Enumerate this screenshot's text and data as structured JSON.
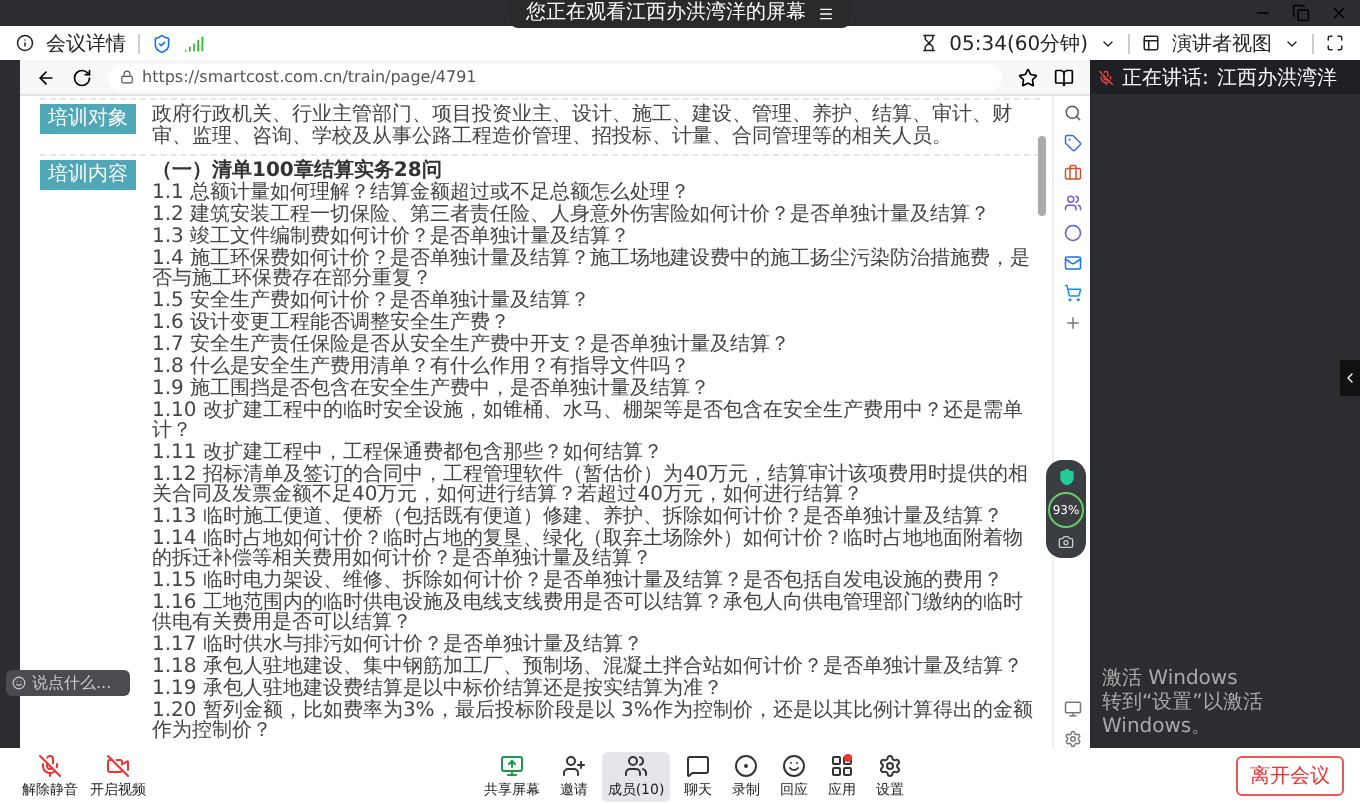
{
  "share_banner": {
    "text": "您正在观看江西办洪湾洋的屏幕"
  },
  "meeting_bar": {
    "details": "会议详情",
    "timer": "05:34(60分钟)",
    "view": "演讲者视图"
  },
  "browser": {
    "url": "https://smartcost.com.cn/train/page/4791"
  },
  "speaking": {
    "label": "正在讲话:",
    "name": "江西办洪湾洋"
  },
  "sections": [
    {
      "label": "培训对象",
      "paragraph": "政府行政机关、行业主管部门、项目投资业主、设计、施工、建设、管理、养护、结算、审计、财审、监理、咨询、学校及从事公路工程造价管理、招投标、计量、合同管理等的相关人员。"
    },
    {
      "label": "培训内容",
      "heading": "（一）清单100章结算实务28问",
      "items": [
        "1.1 总额计量如何理解？结算金额超过或不足总额怎么处理？",
        "1.2 建筑安装工程一切保险、第三者责任险、人身意外伤害险如何计价？是否单独计量及结算？",
        "1.3 竣工文件编制费如何计价？是否单独计量及结算？",
        "1.4 施工环保费如何计价？是否单独计量及结算？施工场地建设费中的施工扬尘污染防治措施费，是否与施工环保费存在部分重复？",
        "1.5 安全生产费如何计价？是否单独计量及结算？",
        "1.6 设计变更工程能否调整安全生产费？",
        "1.7 安全生产责任保险是否从安全生产费中开支？是否单独计量及结算？",
        "1.8 什么是安全生产费用清单？有什么作用？有指导文件吗？",
        "1.9 施工围挡是否包含在安全生产费中，是否单独计量及结算？",
        "1.10 改扩建工程中的临时安全设施，如锥桶、水马、棚架等是否包含在安全生产费用中？还是需单计？",
        "1.11 改扩建工程中，工程保通费都包含那些？如何结算？",
        "1.12 招标清单及签订的合同中，工程管理软件（暂估价）为40万元，结算审计该项费用时提供的相关合同及发票金额不足40万元，如何进行结算？若超过40万元，如何进行结算？",
        "1.13 临时施工便道、便桥（包括既有便道）修建、养护、拆除如何计价？是否单独计量及结算？",
        "1.14 临时占地如何计价？临时占地的复垦、绿化（取弃土场除外）如何计价？临时占地地面附着物的拆迁补偿等相关费用如何计价？是否单独计量及结算？",
        "1.15 临时电力架设、维修、拆除如何计价？是否单独计量及结算？是否包括自发电设施的费用？",
        "1.16 工地范围内的临时供电设施及电线支线费用是否可以结算？承包人向供电管理部门缴纳的临时供电有关费用是否可以结算？",
        "1.17 临时供水与排污如何计价？是否单独计量及结算？",
        "1.18 承包人驻地建设、集中钢筋加工厂、预制场、混凝土拌合站如何计价？是否单独计量及结算？",
        "1.19 承包人驻地建设费结算是以中标价结算还是按实结算为准？",
        "1.20 暂列金额，比如费率为3%，最后投标阶段是以 3%作为控制价，还是以其比例计算得出的金额作为控制价？"
      ]
    }
  ],
  "security_widget": {
    "score": "93",
    "unit": "%"
  },
  "chat_input": {
    "placeholder": "说点什么..."
  },
  "toolbar": {
    "left": [
      {
        "kind": "mic",
        "label": "解除静音",
        "off": true
      },
      {
        "kind": "video",
        "label": "开启视频",
        "off": true
      }
    ],
    "center": [
      {
        "kind": "share",
        "label": "共享屏幕",
        "selected": false,
        "dot": false
      },
      {
        "kind": "invite",
        "label": "邀请",
        "selected": false,
        "dot": false
      },
      {
        "kind": "members",
        "label": "成员(10)",
        "selected": true,
        "dot": false
      },
      {
        "kind": "chat",
        "label": "聊天",
        "selected": false,
        "dot": false
      },
      {
        "kind": "record",
        "label": "录制",
        "selected": false,
        "dot": false
      },
      {
        "kind": "react",
        "label": "回应",
        "selected": false,
        "dot": false
      },
      {
        "kind": "apps",
        "label": "应用",
        "selected": false,
        "dot": true
      },
      {
        "kind": "settings",
        "label": "设置",
        "selected": false,
        "dot": false
      }
    ],
    "leave": "离开会议"
  },
  "os_watermark": {
    "title": "激活 Windows",
    "hint": "转到“设置”以激活 Windows。"
  }
}
